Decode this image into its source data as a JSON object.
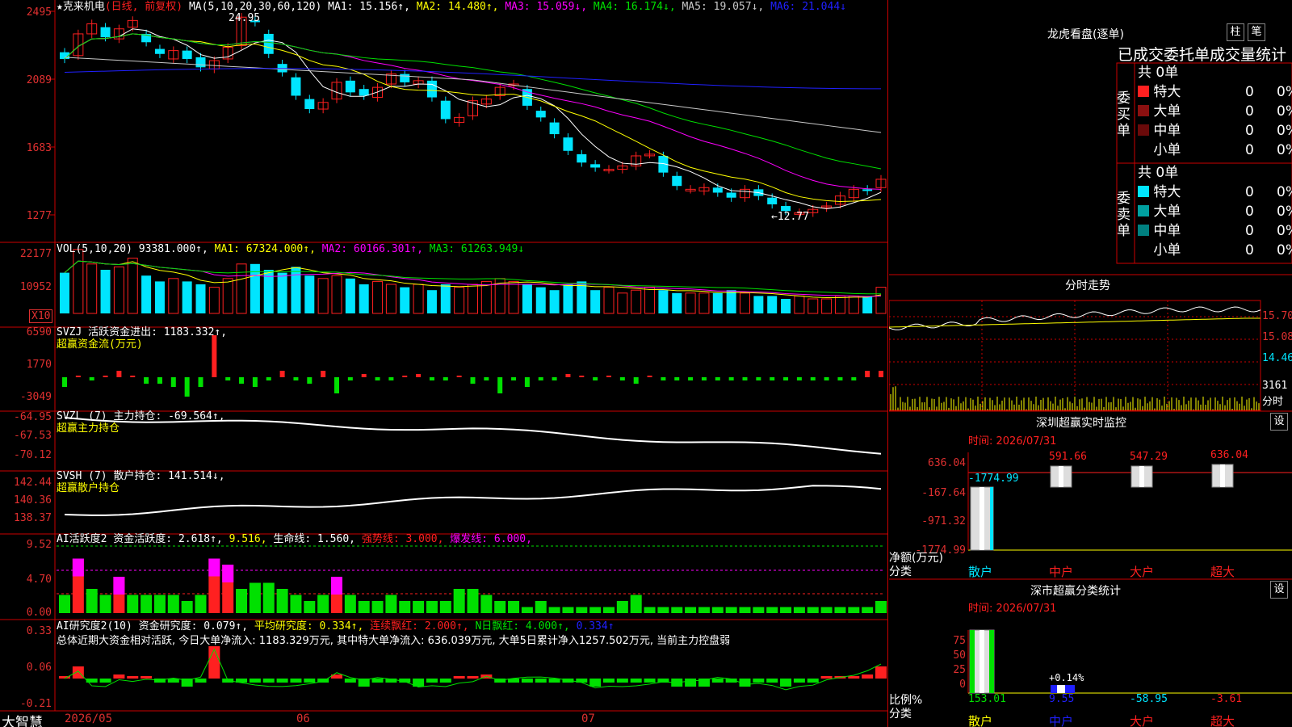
{
  "colors": {
    "up": "#ff2020",
    "down": "#00e5ff",
    "green": "#00e000",
    "ma1": "#ffffff",
    "ma2": "#ffff00",
    "ma3": "#ff00ff",
    "ma4": "#00e000",
    "ma5": "#c8c8c8",
    "ma6": "#2020ff"
  },
  "price": {
    "header": {
      "star": "★克来机电",
      "mode": "(日线, 前复权)",
      "ma_label": "MA(5,10,20,30,60,120)",
      "ma1": "MA1: 15.156↑,",
      "ma2": "MA2: 14.480↑,",
      "ma3": "MA3: 15.059↓,",
      "ma4": "MA4: 16.174↓,",
      "ma5": "MA5: 19.057↓,",
      "ma6": "MA6: 21.044↓"
    },
    "yticks": [
      "2495",
      "2089",
      "1683",
      "1277"
    ],
    "high_note": "24.95",
    "low_note": "←12.77"
  },
  "volume": {
    "header": {
      "a": "VOL(5,10,20) 93381.000↑,",
      "b": "MA1: 67324.000↑,",
      "c": "MA2: 60166.301↑,",
      "d": "MA3: 61263.949↓"
    },
    "yticks": [
      "22177",
      "10952"
    ],
    "unit": "X10"
  },
  "svzj": {
    "header": "SVZJ  活跃资金进出: 1183.332↑,",
    "sub": "超赢资金流(万元)",
    "yticks": [
      "6590",
      "1770",
      "-3049"
    ]
  },
  "svzl": {
    "header": "SVZL (7) 主力持仓: -69.564↑,",
    "sub": "超赢主力持仓",
    "yticks": [
      "-64.95",
      "-67.53",
      "-70.12"
    ]
  },
  "svsh": {
    "header": "SVSH (7) 散户持仓: 141.514↓,",
    "sub": "超赢散户持仓",
    "yticks": [
      "142.44",
      "140.36",
      "138.37"
    ]
  },
  "ai1": {
    "header": {
      "a": "AI活跃度2 资金活跃度: 2.618↑,",
      "b": "9.516,",
      "c": "生命线: 1.560,",
      "d": "强势线: 3.000,",
      "e": "爆发线: 6.000,"
    },
    "yticks": [
      "9.52",
      "4.70",
      "0.00"
    ]
  },
  "ai2": {
    "header": {
      "a": "AI研究度2(10) 资金研究度: 0.079↑,",
      "b": "平均研究度: 0.334↑,",
      "c": "连续飘红: 2.000↑,",
      "d": "N日飘红: 4.000↑,",
      "e": "0.334↑"
    },
    "summary": "总体近期大资金相对活跃, 今日大单净流入: 1183.329万元, 其中特大单净流入: 636.039万元, 大单5日累计净入1257.502万元, 当前主力控盘弱",
    "yticks": [
      "0.33",
      "0.06",
      "-0.21"
    ]
  },
  "footer": {
    "brand": "大智慧",
    "dates": [
      "2026/05",
      "06",
      "07"
    ]
  },
  "dragon": {
    "title": "龙虎看盘(逐单)",
    "btn1": "柱",
    "btn2": "笔",
    "tabs": "已成交委托单成交量统计",
    "buy": {
      "label": "委买单",
      "total": "共 0单",
      "rows": [
        {
          "name": "特大",
          "val": "0",
          "pct": "0%",
          "color": "#ff2020"
        },
        {
          "name": "大单",
          "val": "0",
          "pct": "0%",
          "color": "#8b1010"
        },
        {
          "name": "中单",
          "val": "0",
          "pct": "0%",
          "color": "#6a0a0a"
        },
        {
          "name": "小单",
          "val": "0",
          "pct": "0%",
          "color": "#000000"
        }
      ]
    },
    "sell": {
      "label": "委卖单",
      "total": "共 0单",
      "rows": [
        {
          "name": "特大",
          "val": "0",
          "pct": "0%",
          "color": "#00e5ff"
        },
        {
          "name": "大单",
          "val": "0",
          "pct": "0%",
          "color": "#00a0a0"
        },
        {
          "name": "中单",
          "val": "0",
          "pct": "0%",
          "color": "#008080"
        },
        {
          "name": "小单",
          "val": "0",
          "pct": "0%",
          "color": "#000000"
        }
      ]
    }
  },
  "intraday": {
    "title": "分时走势",
    "yticks": [
      "15.70",
      "15.08",
      "14.46",
      "3161"
    ],
    "vol_label": "分时"
  },
  "monitor": {
    "title": "深圳超赢实时监控",
    "btn": "设",
    "time": "时间: 2026/07/31",
    "yticks": [
      "636.04",
      "-167.64",
      "-971.32",
      "-1774.99"
    ],
    "ylabel": "净额(万元)",
    "xlabel": "分类",
    "cats": [
      "散户",
      "中户",
      "大户",
      "超大"
    ],
    "values": [
      -1774.99,
      591.66,
      547.29,
      636.04
    ],
    "labels": [
      "-1774.99",
      "591.66",
      "547.29",
      "636.04"
    ]
  },
  "classify": {
    "title": "深市超赢分类统计",
    "btn": "设",
    "time": "时间: 2026/07/31",
    "yticks": [
      "75",
      "50",
      "25",
      "0"
    ],
    "ylabel": "比例%",
    "xlabel": "分类",
    "cats": [
      "散户",
      "中户",
      "大户",
      "超大"
    ],
    "values": [
      "153.01",
      "9.55",
      "-58.95",
      "-3.61"
    ],
    "note": "+0.14%"
  }
}
